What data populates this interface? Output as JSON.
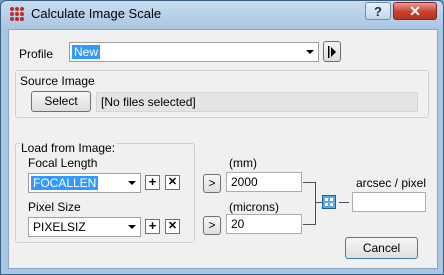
{
  "window": {
    "title": "Calculate Image Scale",
    "help_label": "?",
    "close_label": "✕"
  },
  "profile": {
    "label": "Profile",
    "value": "New"
  },
  "source_image": {
    "group_label": "Source Image",
    "select_label": "Select",
    "selected_files": "[No files selected]"
  },
  "load_from_image": {
    "group_label": "Load from Image:",
    "focal_length": {
      "label": "Focal Length",
      "value": "FOCALLEN",
      "add_label": "+",
      "remove_label": "✕"
    },
    "pixel_size": {
      "label": "Pixel Size",
      "value": "PIXELSIZ",
      "add_label": "+",
      "remove_label": "✕"
    }
  },
  "inputs": {
    "focal_unit": "(mm)",
    "focal_value": "2000",
    "pixel_unit": "(microns)",
    "pixel_value": "20",
    "transfer_label": ">"
  },
  "result": {
    "label": "arcsec / pixel",
    "value": ""
  },
  "cancel_label": "Cancel"
}
